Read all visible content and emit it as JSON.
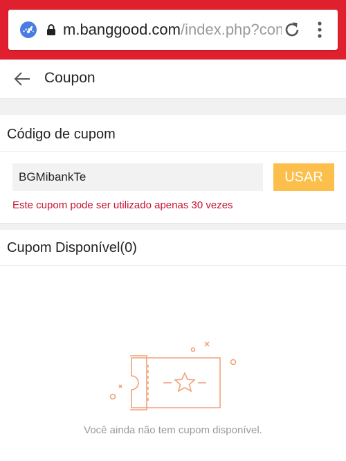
{
  "browser": {
    "url_host": "m.banggood.com",
    "url_path": "/index.php?com",
    "icons": {
      "site": "speedometer-icon",
      "lock": "lock-icon",
      "reload": "reload-icon",
      "menu": "more-vert-icon"
    },
    "accent": "#e0202e"
  },
  "header": {
    "title": "Coupon",
    "back_icon": "arrow-left-icon"
  },
  "coupon_code": {
    "section_title": "Código de cupom",
    "input_value": "BGMibankTe",
    "button_label": "USAR",
    "button_color": "#fcbf4b",
    "message": "Este cupom pode ser utilizado apenas 30 vezes",
    "message_color": "#c8102e"
  },
  "available": {
    "section_title": "Cupom Disponível(0)",
    "empty_icon": "coupon-ticket-star-icon",
    "empty_text": "Você ainda não tem cupom disponível.",
    "illustration_color": "#f0a27a"
  }
}
